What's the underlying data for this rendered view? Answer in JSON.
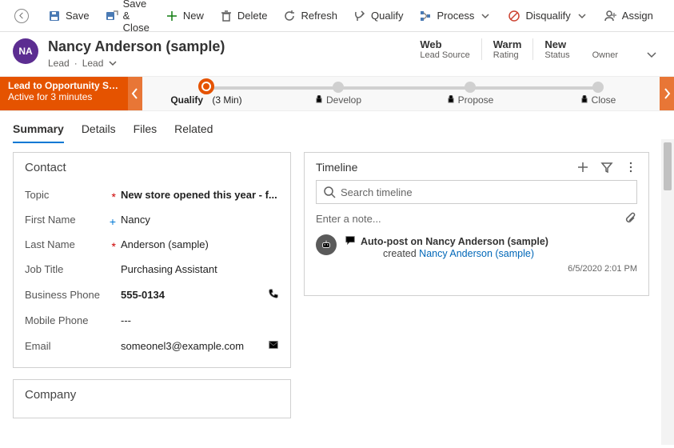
{
  "toolbar": {
    "save": "Save",
    "save_close": "Save & Close",
    "new": "New",
    "delete": "Delete",
    "refresh": "Refresh",
    "qualify": "Qualify",
    "process": "Process",
    "disqualify": "Disqualify",
    "assign": "Assign"
  },
  "header": {
    "avatar_initials": "NA",
    "title": "Nancy Anderson (sample)",
    "entity": "Lead",
    "form": "Lead",
    "fields": {
      "lead_source_value": "Web",
      "lead_source_label": "Lead Source",
      "rating_value": "Warm",
      "rating_label": "Rating",
      "status_value": "New",
      "status_label": "Status",
      "owner_label": "Owner"
    }
  },
  "bpf": {
    "flow_name": "Lead to Opportunity Sale...",
    "active_text": "Active for 3 minutes",
    "stages": {
      "s0_label": "Qualify",
      "s0_time": "(3 Min)",
      "s1_label": "Develop",
      "s2_label": "Propose",
      "s3_label": "Close"
    }
  },
  "tabs": {
    "summary": "Summary",
    "details": "Details",
    "files": "Files",
    "related": "Related"
  },
  "contact": {
    "section_title": "Contact",
    "topic_label": "Topic",
    "topic_value": "New store opened this year - f...",
    "first_name_label": "First Name",
    "first_name_value": "Nancy",
    "last_name_label": "Last Name",
    "last_name_value": "Anderson (sample)",
    "job_title_label": "Job Title",
    "job_title_value": "Purchasing Assistant",
    "bus_phone_label": "Business Phone",
    "bus_phone_value": "555-0134",
    "mob_phone_label": "Mobile Phone",
    "mob_phone_value": "---",
    "email_label": "Email",
    "email_value": "someonel3@example.com"
  },
  "company": {
    "section_title": "Company"
  },
  "timeline": {
    "title": "Timeline",
    "search_placeholder": "Search timeline",
    "note_placeholder": "Enter a note...",
    "item_title": "Auto-post on Nancy Anderson (sample)",
    "item_action": "created ",
    "item_link": "Nancy Anderson (sample)",
    "item_time": "6/5/2020 2:01 PM"
  }
}
